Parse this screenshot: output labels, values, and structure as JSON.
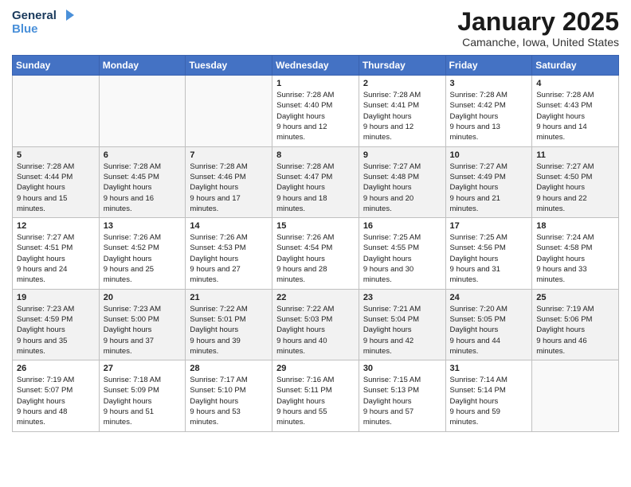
{
  "header": {
    "logo_line1": "General",
    "logo_line2": "Blue",
    "month": "January 2025",
    "location": "Camanche, Iowa, United States"
  },
  "weekdays": [
    "Sunday",
    "Monday",
    "Tuesday",
    "Wednesday",
    "Thursday",
    "Friday",
    "Saturday"
  ],
  "weeks": [
    [
      {
        "day": "",
        "sunrise": "",
        "sunset": "",
        "daylight": ""
      },
      {
        "day": "",
        "sunrise": "",
        "sunset": "",
        "daylight": ""
      },
      {
        "day": "",
        "sunrise": "",
        "sunset": "",
        "daylight": ""
      },
      {
        "day": "1",
        "sunrise": "7:28 AM",
        "sunset": "4:40 PM",
        "daylight": "9 hours and 12 minutes."
      },
      {
        "day": "2",
        "sunrise": "7:28 AM",
        "sunset": "4:41 PM",
        "daylight": "9 hours and 12 minutes."
      },
      {
        "day": "3",
        "sunrise": "7:28 AM",
        "sunset": "4:42 PM",
        "daylight": "9 hours and 13 minutes."
      },
      {
        "day": "4",
        "sunrise": "7:28 AM",
        "sunset": "4:43 PM",
        "daylight": "9 hours and 14 minutes."
      }
    ],
    [
      {
        "day": "5",
        "sunrise": "7:28 AM",
        "sunset": "4:44 PM",
        "daylight": "9 hours and 15 minutes."
      },
      {
        "day": "6",
        "sunrise": "7:28 AM",
        "sunset": "4:45 PM",
        "daylight": "9 hours and 16 minutes."
      },
      {
        "day": "7",
        "sunrise": "7:28 AM",
        "sunset": "4:46 PM",
        "daylight": "9 hours and 17 minutes."
      },
      {
        "day": "8",
        "sunrise": "7:28 AM",
        "sunset": "4:47 PM",
        "daylight": "9 hours and 18 minutes."
      },
      {
        "day": "9",
        "sunrise": "7:27 AM",
        "sunset": "4:48 PM",
        "daylight": "9 hours and 20 minutes."
      },
      {
        "day": "10",
        "sunrise": "7:27 AM",
        "sunset": "4:49 PM",
        "daylight": "9 hours and 21 minutes."
      },
      {
        "day": "11",
        "sunrise": "7:27 AM",
        "sunset": "4:50 PM",
        "daylight": "9 hours and 22 minutes."
      }
    ],
    [
      {
        "day": "12",
        "sunrise": "7:27 AM",
        "sunset": "4:51 PM",
        "daylight": "9 hours and 24 minutes."
      },
      {
        "day": "13",
        "sunrise": "7:26 AM",
        "sunset": "4:52 PM",
        "daylight": "9 hours and 25 minutes."
      },
      {
        "day": "14",
        "sunrise": "7:26 AM",
        "sunset": "4:53 PM",
        "daylight": "9 hours and 27 minutes."
      },
      {
        "day": "15",
        "sunrise": "7:26 AM",
        "sunset": "4:54 PM",
        "daylight": "9 hours and 28 minutes."
      },
      {
        "day": "16",
        "sunrise": "7:25 AM",
        "sunset": "4:55 PM",
        "daylight": "9 hours and 30 minutes."
      },
      {
        "day": "17",
        "sunrise": "7:25 AM",
        "sunset": "4:56 PM",
        "daylight": "9 hours and 31 minutes."
      },
      {
        "day": "18",
        "sunrise": "7:24 AM",
        "sunset": "4:58 PM",
        "daylight": "9 hours and 33 minutes."
      }
    ],
    [
      {
        "day": "19",
        "sunrise": "7:23 AM",
        "sunset": "4:59 PM",
        "daylight": "9 hours and 35 minutes."
      },
      {
        "day": "20",
        "sunrise": "7:23 AM",
        "sunset": "5:00 PM",
        "daylight": "9 hours and 37 minutes."
      },
      {
        "day": "21",
        "sunrise": "7:22 AM",
        "sunset": "5:01 PM",
        "daylight": "9 hours and 39 minutes."
      },
      {
        "day": "22",
        "sunrise": "7:22 AM",
        "sunset": "5:03 PM",
        "daylight": "9 hours and 40 minutes."
      },
      {
        "day": "23",
        "sunrise": "7:21 AM",
        "sunset": "5:04 PM",
        "daylight": "9 hours and 42 minutes."
      },
      {
        "day": "24",
        "sunrise": "7:20 AM",
        "sunset": "5:05 PM",
        "daylight": "9 hours and 44 minutes."
      },
      {
        "day": "25",
        "sunrise": "7:19 AM",
        "sunset": "5:06 PM",
        "daylight": "9 hours and 46 minutes."
      }
    ],
    [
      {
        "day": "26",
        "sunrise": "7:19 AM",
        "sunset": "5:07 PM",
        "daylight": "9 hours and 48 minutes."
      },
      {
        "day": "27",
        "sunrise": "7:18 AM",
        "sunset": "5:09 PM",
        "daylight": "9 hours and 51 minutes."
      },
      {
        "day": "28",
        "sunrise": "7:17 AM",
        "sunset": "5:10 PM",
        "daylight": "9 hours and 53 minutes."
      },
      {
        "day": "29",
        "sunrise": "7:16 AM",
        "sunset": "5:11 PM",
        "daylight": "9 hours and 55 minutes."
      },
      {
        "day": "30",
        "sunrise": "7:15 AM",
        "sunset": "5:13 PM",
        "daylight": "9 hours and 57 minutes."
      },
      {
        "day": "31",
        "sunrise": "7:14 AM",
        "sunset": "5:14 PM",
        "daylight": "9 hours and 59 minutes."
      },
      {
        "day": "",
        "sunrise": "",
        "sunset": "",
        "daylight": ""
      }
    ]
  ]
}
